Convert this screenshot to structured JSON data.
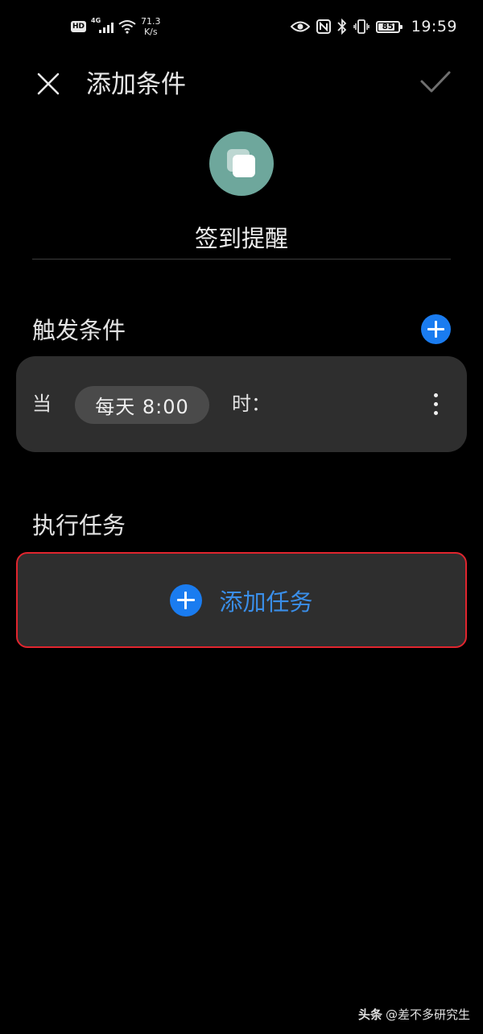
{
  "status_bar": {
    "hd": "HD",
    "network_gen": "4G",
    "net_speed_value": "71.3",
    "net_speed_unit": "K/s",
    "battery_level": "85",
    "battery_fraction": 0.85,
    "time": "19:59",
    "icons": [
      "hd-icon",
      "signal-icon",
      "wifi-icon",
      "eye-icon",
      "nfc-icon",
      "bluetooth-icon",
      "vibrate-icon",
      "battery-icon"
    ]
  },
  "header": {
    "title": "添加条件",
    "close_icon": "close-icon",
    "confirm_icon": "check-icon"
  },
  "scene": {
    "icon": "layers-icon",
    "icon_color": "#6ea79c",
    "name": "签到提醒"
  },
  "trigger": {
    "section_title": "触发条件",
    "add_icon": "plus-icon",
    "when_label": "当",
    "schedule": "每天 8:00",
    "at_label": "时：",
    "more_icon": "more-vertical-icon"
  },
  "task": {
    "section_title": "执行任务",
    "add_label": "添加任务",
    "add_icon": "plus-icon"
  },
  "watermark": {
    "brand": "头条",
    "author": "@差不多研究生"
  },
  "colors": {
    "accent": "#1a7cf0",
    "highlight_border": "#e0252e",
    "card": "#2e2e2e",
    "background": "#000000"
  }
}
